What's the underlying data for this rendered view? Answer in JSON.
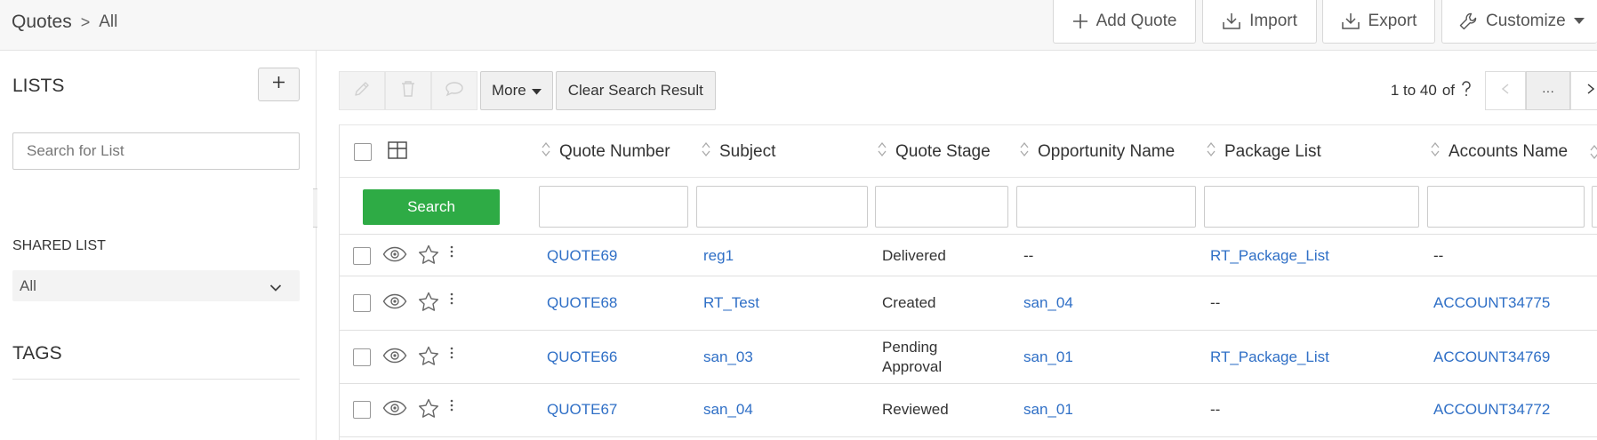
{
  "breadcrumb": {
    "module": "Quotes",
    "separator": ">",
    "view": "All"
  },
  "header_actions": {
    "add_quote": "Add Quote",
    "import": "Import",
    "export": "Export",
    "customize": "Customize"
  },
  "sidebar": {
    "lists_title": "LISTS",
    "search_placeholder": "Search for List",
    "shared_list_title": "SHARED LIST",
    "shared_list_selected": "All",
    "tags_title": "TAGS"
  },
  "toolbar": {
    "more_label": "More",
    "clear_search_label": "Clear Search Result"
  },
  "pager": {
    "range": "1 to 40",
    "of_label": "of",
    "ellipsis": "···"
  },
  "table": {
    "columns": [
      "Quote Number",
      "Subject",
      "Quote Stage",
      "Opportunity Name",
      "Package List",
      "Accounts Name"
    ],
    "search_label": "Search",
    "rows": [
      {
        "quote_number": "QUOTE69",
        "subject": "reg1",
        "stage": "Delivered",
        "opportunity": "--",
        "package": "RT_Package_List",
        "account": "--"
      },
      {
        "quote_number": "QUOTE68",
        "subject": "RT_Test",
        "stage": "Created",
        "opportunity": "san_04",
        "package": "--",
        "account": "ACCOUNT34775"
      },
      {
        "quote_number": "QUOTE66",
        "subject": "san_03",
        "stage": "Pending Approval",
        "opportunity": "san_01",
        "package": "RT_Package_List",
        "account": "ACCOUNT34769"
      },
      {
        "quote_number": "QUOTE67",
        "subject": "san_04",
        "stage": "Reviewed",
        "opportunity": "san_01",
        "package": "--",
        "account": "ACCOUNT34772"
      }
    ]
  },
  "colors": {
    "link": "#2f6fc6",
    "search_button": "#2eab45"
  }
}
